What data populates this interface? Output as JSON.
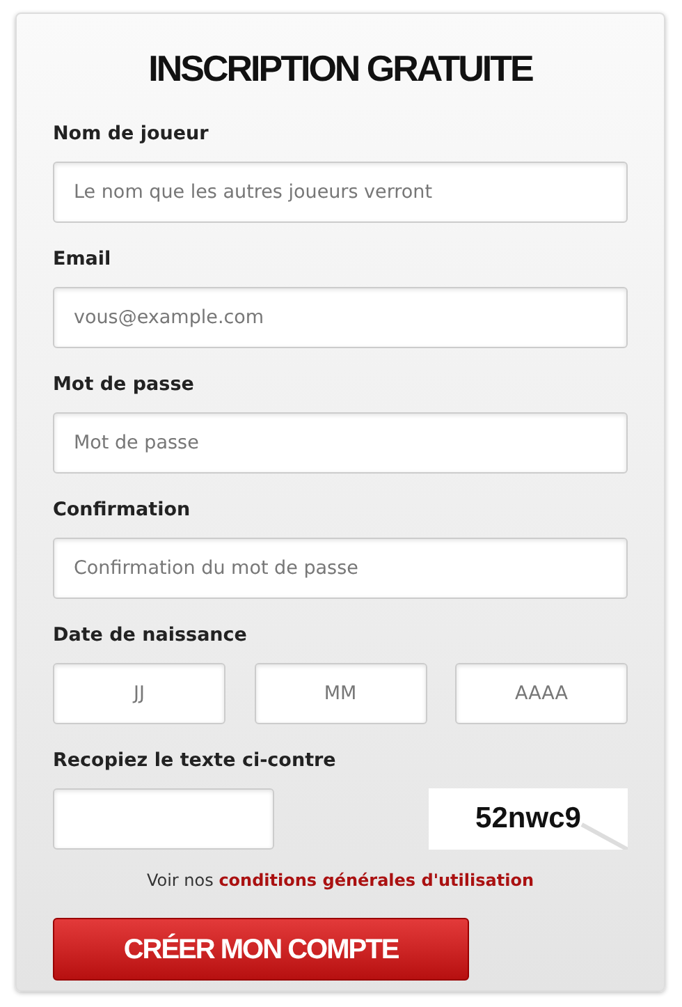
{
  "title": "INSCRIPTION GRATUITE",
  "fields": [
    {
      "label": "Nom de joueur",
      "placeholder": "Le nom que les autres joueurs verront"
    },
    {
      "label": "Email",
      "placeholder": "vous@example.com"
    },
    {
      "label": "Mot de passe",
      "placeholder": "Mot de passe"
    },
    {
      "label": "Confirmation",
      "placeholder": "Confirmation du mot de passe"
    }
  ],
  "birth_date": {
    "label": "Date de naissance",
    "parts": [
      {
        "placeholder": "JJ"
      },
      {
        "placeholder": "MM"
      },
      {
        "placeholder": "AAAA"
      }
    ]
  },
  "captcha": {
    "label": "Recopiez le texte ci-contre",
    "code": "52nwc9"
  },
  "terms": {
    "prefix": "Voir nos",
    "link": "conditions générales d'utilisation"
  },
  "submit": "CRÉER MON COMPTE"
}
